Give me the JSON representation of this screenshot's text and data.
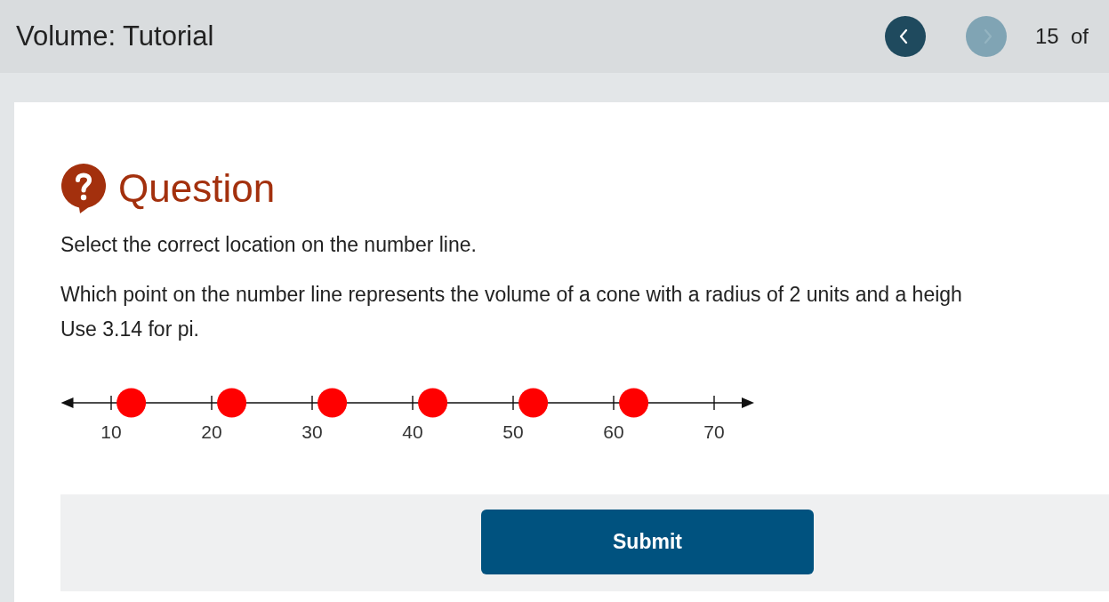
{
  "header": {
    "title": "Volume: Tutorial",
    "nav": [
      {
        "kind": "previous",
        "disabled": false
      },
      {
        "kind": "next",
        "disabled": true
      }
    ],
    "page_counter": "15  of"
  },
  "question": {
    "heading": "Question",
    "instruction": "Select the correct location on the number line.",
    "prompt_lines": [
      "Which point on the number line represents the volume of a cone with a radius of 2 units and a heigh",
      "Use 3.14 for pi."
    ],
    "number_line": {
      "tick_labels": [
        "10",
        "20",
        "30",
        "40",
        "50",
        "60",
        "70"
      ],
      "points": [
        {
          "selected": false
        },
        {
          "selected": false
        },
        {
          "selected": false
        },
        {
          "selected": false
        },
        {
          "selected": false
        },
        {
          "selected": false
        }
      ]
    }
  },
  "submit_button": {
    "label": "Submit"
  }
}
